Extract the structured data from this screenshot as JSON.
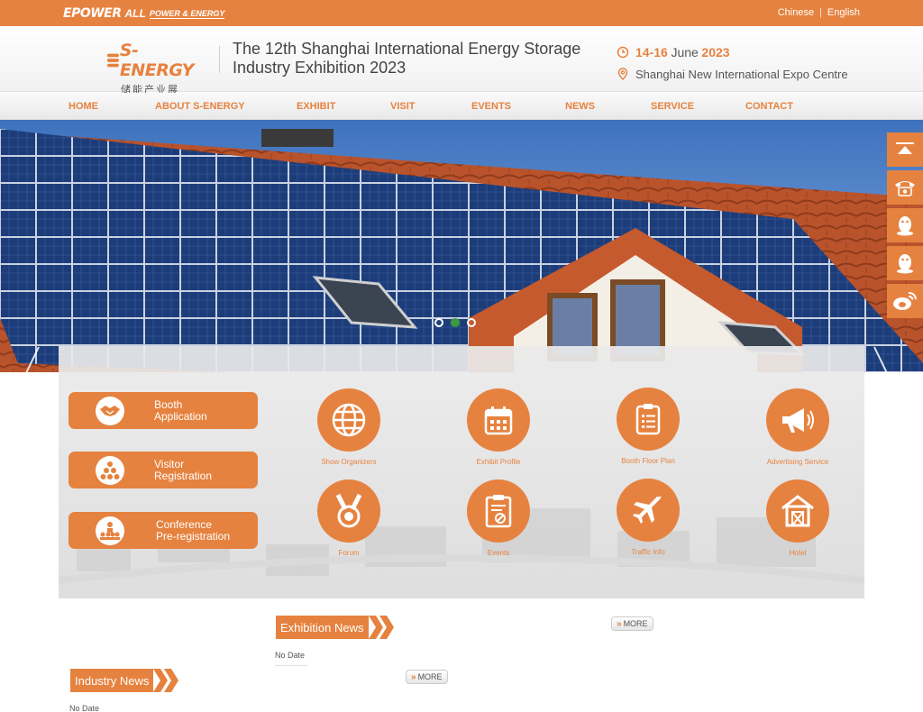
{
  "topbar": {
    "brand_epower": "EPOWER",
    "brand_all": "ALL",
    "brand_tag": "POWER & ENERGY",
    "lang_chinese": "Chinese",
    "lang_sep": "|",
    "lang_english": "English"
  },
  "header": {
    "logo_word": "S-ENERGY",
    "logo_sub": "储能产业展",
    "title_line1": "The 12th Shanghai International Energy Storage",
    "title_line2": "Industry Exhibition 2023",
    "date_days": "14-16",
    "date_month": "June",
    "date_year": "2023",
    "venue": "Shanghai New International Expo Centre"
  },
  "nav": [
    "HOME",
    "ABOUT S-ENERGY",
    "EXHIBIT",
    "VISIT",
    "EVENTS",
    "NEWS",
    "SERVICE",
    "CONTACT"
  ],
  "banner": {
    "slides": 3,
    "active_slide": 2
  },
  "sidefloat": [
    "top-arrow-icon",
    "phone-icon",
    "qq-icon",
    "qq-icon",
    "weibo-icon"
  ],
  "actions": [
    {
      "line1": "Booth",
      "line2": "Application",
      "icon": "handshake-icon"
    },
    {
      "line1": "Visitor",
      "line2": "Registration",
      "icon": "people-icon"
    },
    {
      "line1": "Conference",
      "line2": "Pre-registration",
      "icon": "audience-icon"
    }
  ],
  "services": [
    {
      "label": "Show Organizers",
      "icon": "globe-icon"
    },
    {
      "label": "Exhibit Profile",
      "icon": "calendar-icon"
    },
    {
      "label": "Booth Floor Plan",
      "icon": "clipboard-icon"
    },
    {
      "label": "Advertising Service",
      "icon": "megaphone-icon"
    },
    {
      "label": "Forum",
      "icon": "medal-icon"
    },
    {
      "label": "Events",
      "icon": "document-icon"
    },
    {
      "label": "Traffic Info",
      "icon": "airplane-icon"
    },
    {
      "label": "Hotel",
      "icon": "house-icon"
    }
  ],
  "news": {
    "exhibition_title": "Exhibition News",
    "exhibition_date": "No Date",
    "industry_title": "Industry News",
    "industry_date": "No Date",
    "more_label": "MORE"
  },
  "colors": {
    "accent": "#e6823f",
    "active_dot": "#3c9a3c"
  }
}
